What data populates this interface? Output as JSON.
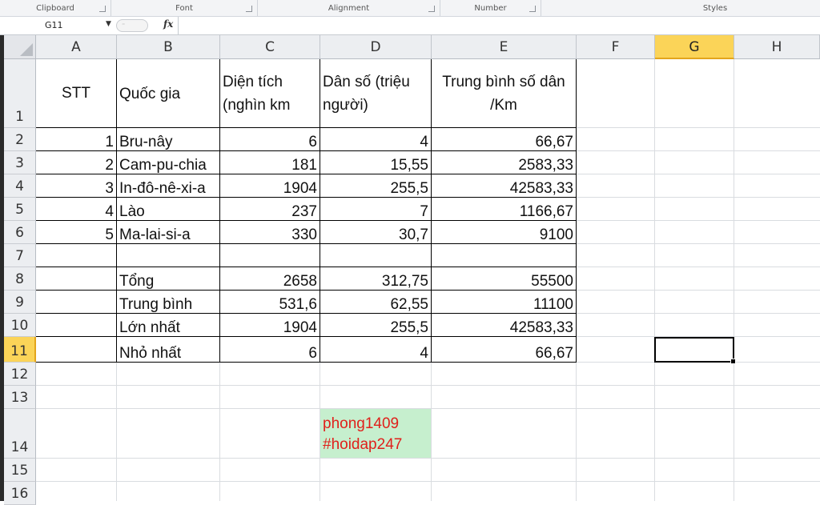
{
  "ribbon": {
    "groups": [
      "Clipboard",
      "Font",
      "Alignment",
      "Number",
      "Styles"
    ]
  },
  "formula_bar": {
    "name_box": "G11",
    "fx_label": "fx",
    "formula": ""
  },
  "columns": [
    "A",
    "B",
    "C",
    "D",
    "E",
    "F",
    "G",
    "H"
  ],
  "rows": [
    "1",
    "2",
    "3",
    "4",
    "5",
    "6",
    "7",
    "8",
    "9",
    "10",
    "11",
    "12",
    "13",
    "14",
    "15",
    "16"
  ],
  "selected": {
    "column": "G",
    "row": "11",
    "cell": "G11"
  },
  "table": {
    "headers": {
      "stt": "STT",
      "country": "Quốc gia",
      "area": "Diện tích (nghìn km",
      "population": "Dân số (triệu người)",
      "density": "Trung bình số dân /Km"
    },
    "data_rows": [
      {
        "stt": "1",
        "country": "Bru-nây",
        "area": "6",
        "population": "4",
        "density": "66,67"
      },
      {
        "stt": "2",
        "country": "Cam-pu-chia",
        "area": "181",
        "population": "15,55",
        "density": "2583,33"
      },
      {
        "stt": "3",
        "country": "In-đô-nê-xi-a",
        "area": "1904",
        "population": "255,5",
        "density": "42583,33"
      },
      {
        "stt": "4",
        "country": "Lào",
        "area": "237",
        "population": "7",
        "density": "1166,67"
      },
      {
        "stt": "5",
        "country": "Ma-lai-si-a",
        "area": "330",
        "population": "30,7",
        "density": "9100"
      }
    ],
    "summary_rows": [
      {
        "label": "Tổng",
        "area": "2658",
        "population": "312,75",
        "density": "55500"
      },
      {
        "label": "Trung bình",
        "area": "531,6",
        "population": "62,55",
        "density": "11100"
      },
      {
        "label": "Lớn nhất",
        "area": "1904",
        "population": "255,5",
        "density": "42583,33"
      },
      {
        "label": "Nhỏ nhất",
        "area": "6",
        "population": "4",
        "density": "66,67"
      }
    ]
  },
  "watermark": {
    "line1": "phong1409",
    "line2": "#hoidap247"
  },
  "colors": {
    "selected_header": "#fbd458",
    "note_fill": "#c6efce",
    "note_text": "#e0201b"
  }
}
